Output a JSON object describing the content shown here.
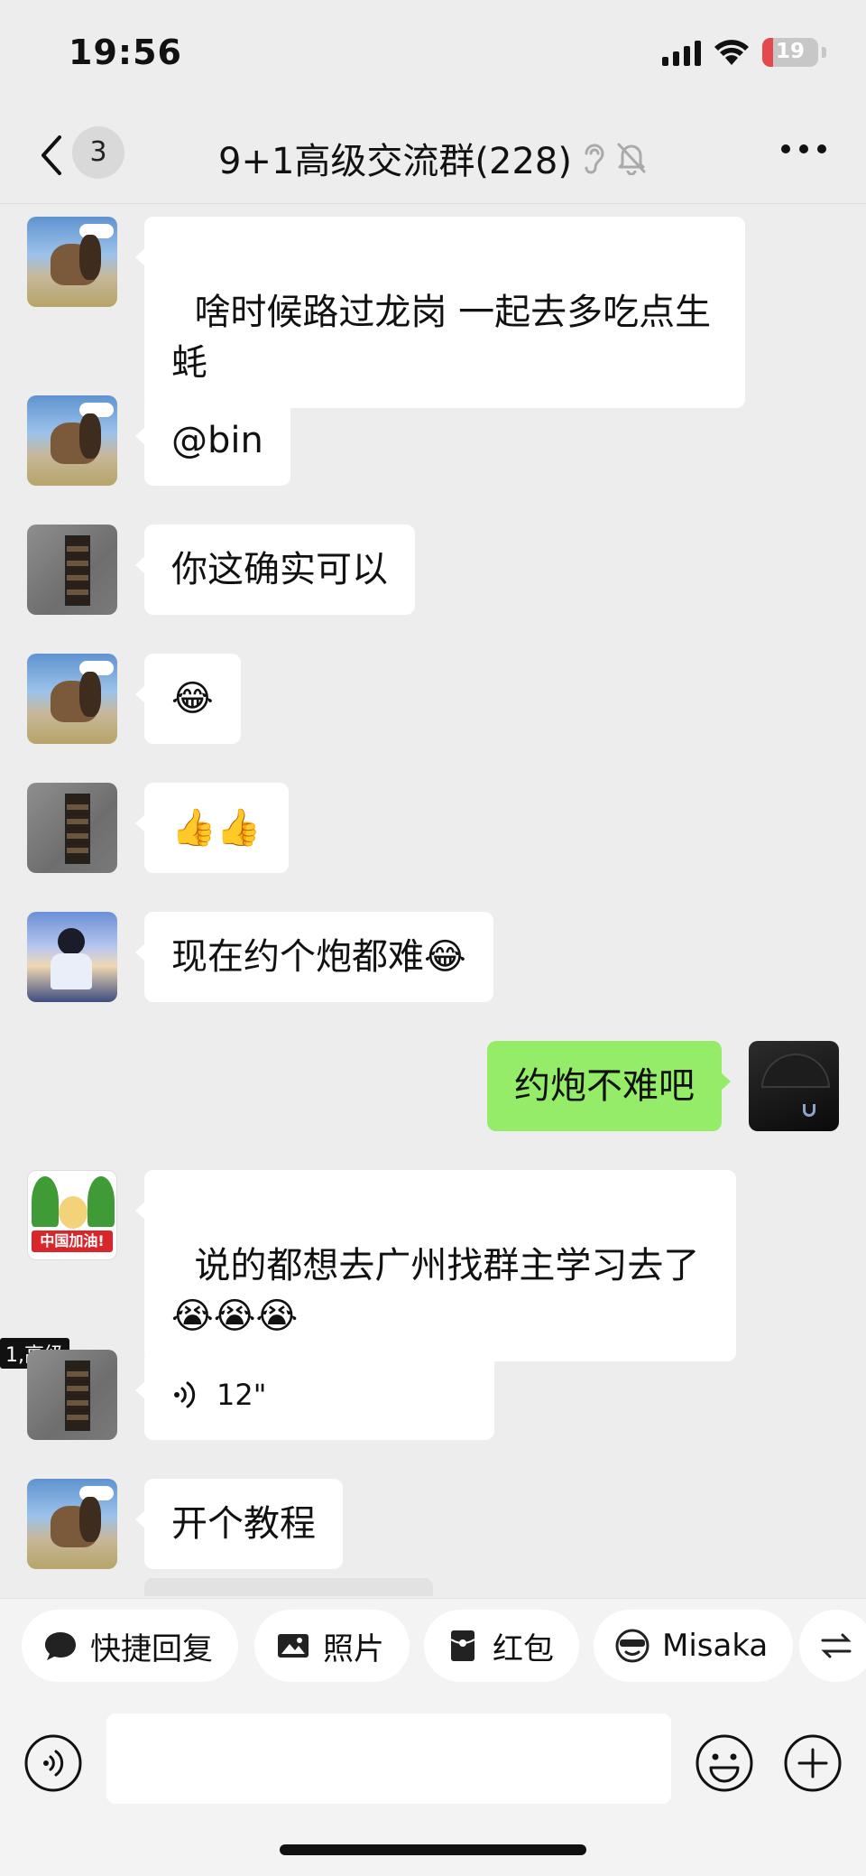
{
  "status_bar": {
    "time": "19:56",
    "battery": "19",
    "battery_level": 0.19,
    "battery_color": "#e5484d"
  },
  "nav": {
    "unread_count": "3",
    "title": "9+1高级交流群(228)",
    "icons": [
      "back-icon",
      "ear-icon",
      "mute-bell-icon",
      "more-icon"
    ]
  },
  "messages": [
    {
      "sender": "other",
      "avatar": "horse",
      "text": "啥时候路过龙岗 一起去多吃点生\n蚝"
    },
    {
      "sender": "other",
      "avatar": "horse",
      "text": "@bin"
    },
    {
      "sender": "other",
      "avatar": "wall",
      "text": "你这确实可以"
    },
    {
      "sender": "other",
      "avatar": "horse",
      "text": "😂"
    },
    {
      "sender": "other",
      "avatar": "wall",
      "text": "👍👍"
    },
    {
      "sender": "other",
      "avatar": "anime",
      "text": "现在约个炮都难😂"
    },
    {
      "sender": "self",
      "avatar": "umbrella",
      "text": "约炮不难吧"
    },
    {
      "sender": "other",
      "avatar": "china",
      "text": "说的都想去广州找群主学习去了\n😭😭😭"
    },
    {
      "sender": "other",
      "avatar": "wall",
      "name_tag": "1,高级",
      "voice_duration": "12\""
    },
    {
      "sender": "other",
      "avatar": "horse",
      "text": "开个教程"
    }
  ],
  "china_avatar_banner": "中国加油!",
  "quick_actions": [
    {
      "label": "快捷回复",
      "icon": "chat-bubble-icon"
    },
    {
      "label": "照片",
      "icon": "photo-icon"
    },
    {
      "label": "红包",
      "icon": "red-packet-icon"
    },
    {
      "label": "Misaka",
      "icon": "sunglasses-face-icon"
    }
  ],
  "input": {
    "value": "",
    "placeholder": ""
  },
  "colors": {
    "background": "#ededed",
    "self_bubble": "#95ec69",
    "other_bubble": "#ffffff"
  }
}
